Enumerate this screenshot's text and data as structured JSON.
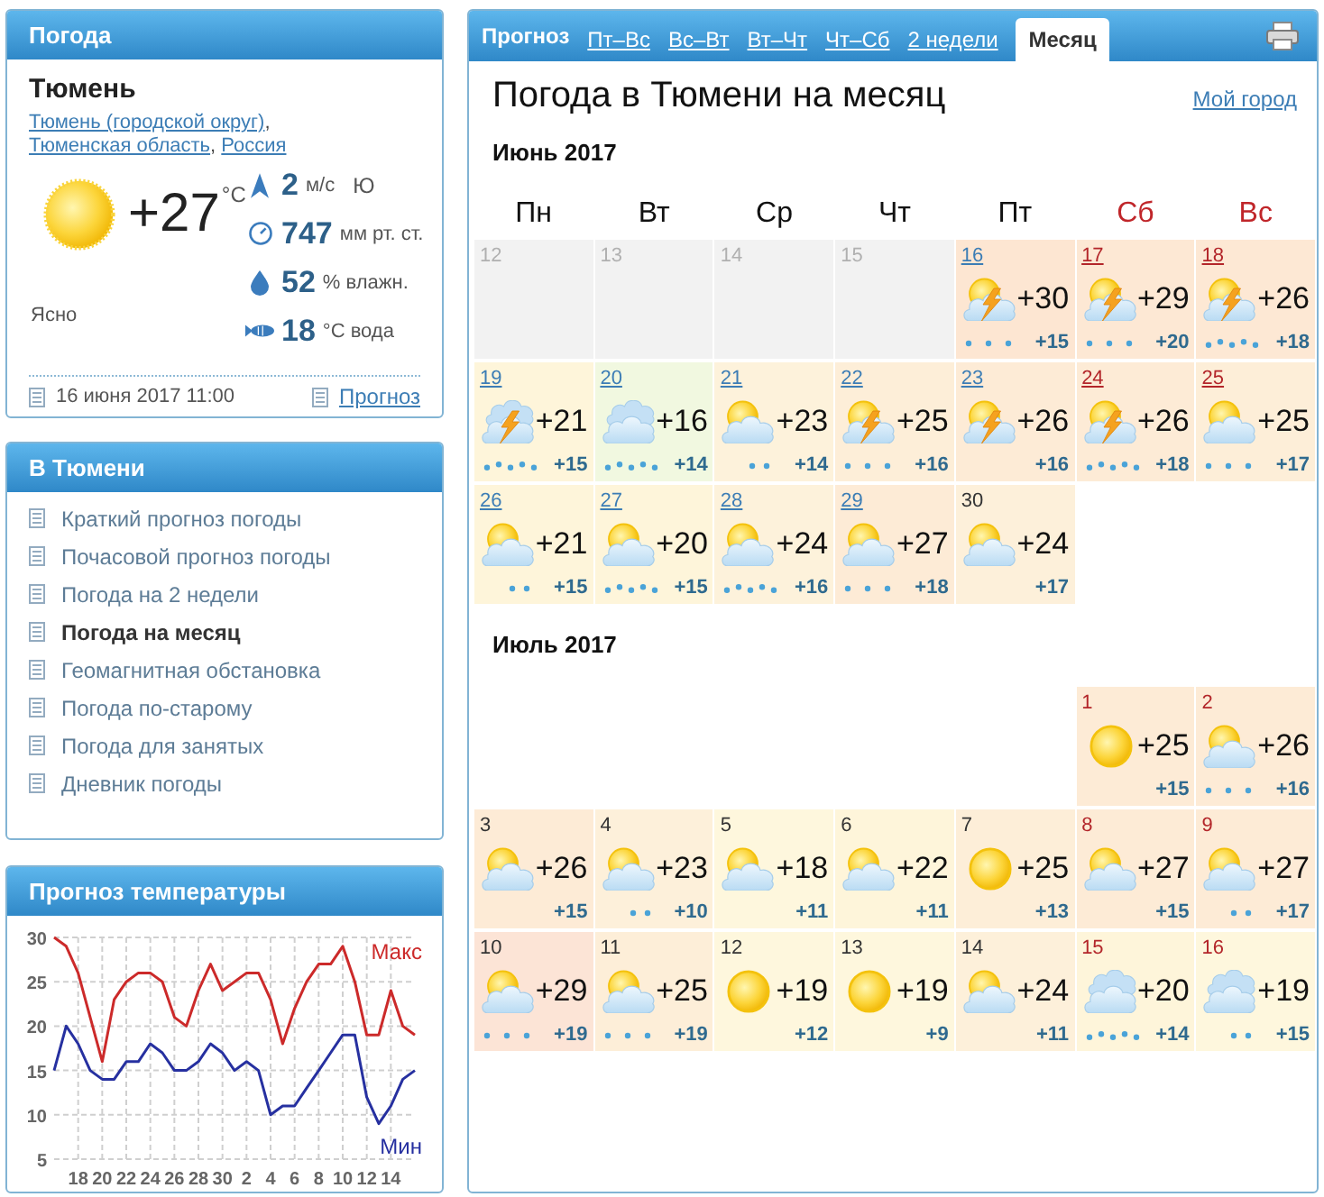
{
  "weather_panel": {
    "title": "Погода",
    "city": "Тюмень",
    "location": [
      {
        "text": "Тюмень (городской округ)",
        "link": true
      },
      {
        "text": ", ",
        "link": false
      },
      {
        "text": "Тюменская область",
        "link": true
      },
      {
        "text": ", ",
        "link": false
      },
      {
        "text": "Россия",
        "link": true
      }
    ],
    "temperature": "+27",
    "temperature_unit": "°C",
    "condition": "Ясно",
    "stats": [
      {
        "kind": "wind",
        "value": "2",
        "unit": "м/с",
        "direction": "Ю"
      },
      {
        "kind": "pressure",
        "value": "747",
        "unit": "мм рт. ст."
      },
      {
        "kind": "humidity",
        "value": "52",
        "unit": "% влажн."
      },
      {
        "kind": "water",
        "value": "18",
        "unit": "°C вода"
      }
    ],
    "updated": "16 июня 2017 11:00",
    "forecast_link": "Прогноз"
  },
  "nav_panel": {
    "title": "В Тюмени",
    "items": [
      {
        "label": "Краткий прогноз погоды",
        "selected": false
      },
      {
        "label": "Почасовой прогноз погоды",
        "selected": false
      },
      {
        "label": "Погода на 2 недели",
        "selected": false
      },
      {
        "label": "Погода на месяц",
        "selected": true
      },
      {
        "label": "Геомагнитная обстановка",
        "selected": false
      },
      {
        "label": "Погода по-старому",
        "selected": false
      },
      {
        "label": "Погода для занятых",
        "selected": false
      },
      {
        "label": "Дневник погоды",
        "selected": false
      }
    ]
  },
  "chart_panel": {
    "title": "Прогноз температуры",
    "chart_data": {
      "type": "line",
      "categories": [
        null,
        null,
        "18",
        null,
        "20",
        null,
        "22",
        null,
        "24",
        null,
        "26",
        null,
        "28",
        null,
        "30",
        null,
        "2",
        null,
        "4",
        null,
        "6",
        null,
        "8",
        null,
        "10",
        null,
        "12",
        null,
        "14",
        null,
        null
      ],
      "series": [
        {
          "name": "Макс",
          "color": "#cc2a2a",
          "values": [
            30,
            29,
            26,
            21,
            16,
            23,
            25,
            26,
            26,
            25,
            21,
            20,
            24,
            27,
            24,
            25,
            26,
            26,
            23,
            18,
            22,
            25,
            27,
            27,
            29,
            25,
            19,
            19,
            24,
            20,
            19
          ]
        },
        {
          "name": "Мин",
          "color": "#2630a0",
          "values": [
            15,
            20,
            18,
            15,
            14,
            14,
            16,
            16,
            18,
            17,
            15,
            15,
            16,
            18,
            17,
            15,
            16,
            15,
            10,
            11,
            11,
            13,
            15,
            17,
            19,
            19,
            12,
            9,
            11,
            14,
            15
          ]
        }
      ],
      "ylim": [
        5,
        30
      ],
      "yticks": [
        5,
        10,
        15,
        20,
        25,
        30
      ],
      "grid": true
    }
  },
  "forecast_panel": {
    "tabs_label": "Прогноз",
    "tabs": [
      {
        "label": "Пт–Вс",
        "selected": false
      },
      {
        "label": "Вс–Вт",
        "selected": false
      },
      {
        "label": "Вт–Чт",
        "selected": false
      },
      {
        "label": "Чт–Сб",
        "selected": false
      },
      {
        "label": "2 недели",
        "selected": false
      },
      {
        "label": "Месяц",
        "selected": true
      }
    ],
    "title": "Погода в Тюмени на месяц",
    "my_city_link": "Мой город",
    "weekdays": [
      {
        "label": "Пн",
        "weekend": false
      },
      {
        "label": "Вт",
        "weekend": false
      },
      {
        "label": "Ср",
        "weekend": false
      },
      {
        "label": "Чт",
        "weekend": false
      },
      {
        "label": "Пт",
        "weekend": false
      },
      {
        "label": "Сб",
        "weekend": true
      },
      {
        "label": "Вс",
        "weekend": true
      }
    ],
    "months": [
      {
        "title": "Июнь 2017",
        "weeks": [
          [
            {
              "date": "12",
              "kind": "past",
              "color": "#f2f2f2"
            },
            {
              "date": "13",
              "kind": "past",
              "color": "#f2f2f2"
            },
            {
              "date": "14",
              "kind": "past",
              "color": "#f2f2f2"
            },
            {
              "date": "15",
              "kind": "past",
              "color": "#f2f2f2"
            },
            {
              "date": "16",
              "kind": "partly_cloudy",
              "link": true,
              "color": "#fde6d2",
              "thunder": true,
              "precip": {
                "kind": "moderate"
              },
              "high": "+30",
              "low": "+15"
            },
            {
              "date": "17",
              "kind": "partly_cloudy",
              "link": true,
              "color": "#fde8d4",
              "thunder": true,
              "precip": {
                "kind": "moderate"
              },
              "high": "+29",
              "low": "+20"
            },
            {
              "date": "18",
              "kind": "partly_cloudy",
              "link": true,
              "color": "#fde8d4",
              "thunder": true,
              "precip": {
                "kind": "heavy"
              },
              "high": "+26",
              "low": "+18"
            }
          ],
          [
            {
              "date": "19",
              "kind": "overcast",
              "link": true,
              "color": "#fef5da",
              "thunder": true,
              "precip": {
                "kind": "heavy"
              },
              "high": "+21",
              "low": "+15"
            },
            {
              "date": "20",
              "kind": "overcast",
              "link": true,
              "color": "#f1f8e0",
              "thunder": false,
              "precip": {
                "kind": "heavy"
              },
              "high": "+16",
              "low": "+14"
            },
            {
              "date": "21",
              "kind": "partly_cloudy",
              "link": true,
              "color": "#fdf2db",
              "thunder": false,
              "precip": {
                "kind": "light"
              },
              "high": "+23",
              "low": "+14"
            },
            {
              "date": "22",
              "kind": "partly_cloudy",
              "link": true,
              "color": "#fdeed8",
              "thunder": true,
              "precip": {
                "kind": "moderate"
              },
              "high": "+25",
              "low": "+16"
            },
            {
              "date": "23",
              "kind": "partly_cloudy",
              "link": true,
              "color": "#fdebd6",
              "thunder": true,
              "high": "+26",
              "low": "+16"
            },
            {
              "date": "24",
              "kind": "partly_cloudy",
              "link": true,
              "color": "#fdebd6",
              "thunder": true,
              "precip": {
                "kind": "heavy"
              },
              "high": "+26",
              "low": "+18"
            },
            {
              "date": "25",
              "kind": "partly_cloudy",
              "link": true,
              "color": "#fdeed8",
              "thunder": false,
              "precip": {
                "kind": "moderate"
              },
              "high": "+25",
              "low": "+17"
            }
          ],
          [
            {
              "date": "26",
              "kind": "partly_cloudy",
              "link": true,
              "color": "#fef5da",
              "thunder": false,
              "precip": {
                "kind": "light"
              },
              "high": "+21",
              "low": "+15"
            },
            {
              "date": "27",
              "kind": "partly_cloudy",
              "link": true,
              "color": "#fef5da",
              "thunder": false,
              "precip": {
                "kind": "heavy"
              },
              "high": "+20",
              "low": "+15"
            },
            {
              "date": "28",
              "kind": "partly_cloudy",
              "link": true,
              "color": "#fdf2db",
              "thunder": false,
              "precip": {
                "kind": "heavy"
              },
              "high": "+24",
              "low": "+16"
            },
            {
              "date": "29",
              "kind": "partly_cloudy",
              "link": true,
              "color": "#fdebd6",
              "thunder": false,
              "precip": {
                "kind": "moderate"
              },
              "high": "+27",
              "low": "+18"
            },
            {
              "date": "30",
              "kind": "partly_cloudy",
              "link": false,
              "color": "#fdf0da",
              "thunder": false,
              "high": "+24",
              "low": "+17"
            }
          ]
        ]
      },
      {
        "title": "Июль 2017",
        "weeks": [
          [
            {
              "date": "1",
              "kind": "clear",
              "link": false,
              "color": "#fdebd6",
              "thunder": false,
              "high": "+25",
              "low": "+15"
            },
            {
              "date": "2",
              "kind": "partly_cloudy",
              "link": false,
              "color": "#fdebd6",
              "thunder": false,
              "precip": {
                "kind": "moderate"
              },
              "high": "+26",
              "low": "+16"
            }
          ],
          [
            {
              "date": "3",
              "kind": "partly_cloudy",
              "link": false,
              "color": "#fdebd6",
              "thunder": false,
              "high": "+26",
              "low": "+15"
            },
            {
              "date": "4",
              "kind": "partly_cloudy",
              "link": false,
              "color": "#fdf0da",
              "thunder": false,
              "precip": {
                "kind": "light"
              },
              "high": "+23",
              "low": "+10"
            },
            {
              "date": "5",
              "kind": "partly_cloudy",
              "link": false,
              "color": "#fef7dd",
              "thunder": false,
              "high": "+18",
              "low": "+11"
            },
            {
              "date": "6",
              "kind": "partly_cloudy",
              "link": false,
              "color": "#fef5da",
              "thunder": false,
              "high": "+22",
              "low": "+11"
            },
            {
              "date": "7",
              "kind": "clear",
              "link": false,
              "color": "#fdeed8",
              "thunder": false,
              "high": "+25",
              "low": "+13"
            },
            {
              "date": "8",
              "kind": "partly_cloudy",
              "link": false,
              "color": "#fdebd6",
              "thunder": false,
              "high": "+27",
              "low": "+15"
            },
            {
              "date": "9",
              "kind": "partly_cloudy",
              "link": false,
              "color": "#fdebd6",
              "thunder": false,
              "precip": {
                "kind": "light"
              },
              "high": "+27",
              "low": "+17"
            }
          ],
          [
            {
              "date": "10",
              "kind": "partly_cloudy",
              "link": false,
              "color": "#fce4d6",
              "thunder": false,
              "precip": {
                "kind": "moderate"
              },
              "high": "+29",
              "low": "+19"
            },
            {
              "date": "11",
              "kind": "partly_cloudy",
              "link": false,
              "color": "#fdeed8",
              "thunder": false,
              "precip": {
                "kind": "moderate"
              },
              "high": "+25",
              "low": "+19"
            },
            {
              "date": "12",
              "kind": "clear",
              "link": false,
              "color": "#fef7dd",
              "thunder": false,
              "high": "+19",
              "low": "+12"
            },
            {
              "date": "13",
              "kind": "clear",
              "link": false,
              "color": "#fef7dd",
              "thunder": false,
              "high": "+19",
              "low": "+9"
            },
            {
              "date": "14",
              "kind": "partly_cloudy",
              "link": false,
              "color": "#fdf0da",
              "thunder": false,
              "high": "+24",
              "low": "+11"
            },
            {
              "date": "15",
              "kind": "overcast",
              "link": false,
              "color": "#fef5da",
              "thunder": false,
              "precip": {
                "kind": "heavy"
              },
              "high": "+20",
              "low": "+14"
            },
            {
              "date": "16",
              "kind": "overcast",
              "link": false,
              "color": "#fef7dd",
              "thunder": false,
              "precip": {
                "kind": "light"
              },
              "high": "+19",
              "low": "+15"
            }
          ]
        ]
      }
    ]
  }
}
